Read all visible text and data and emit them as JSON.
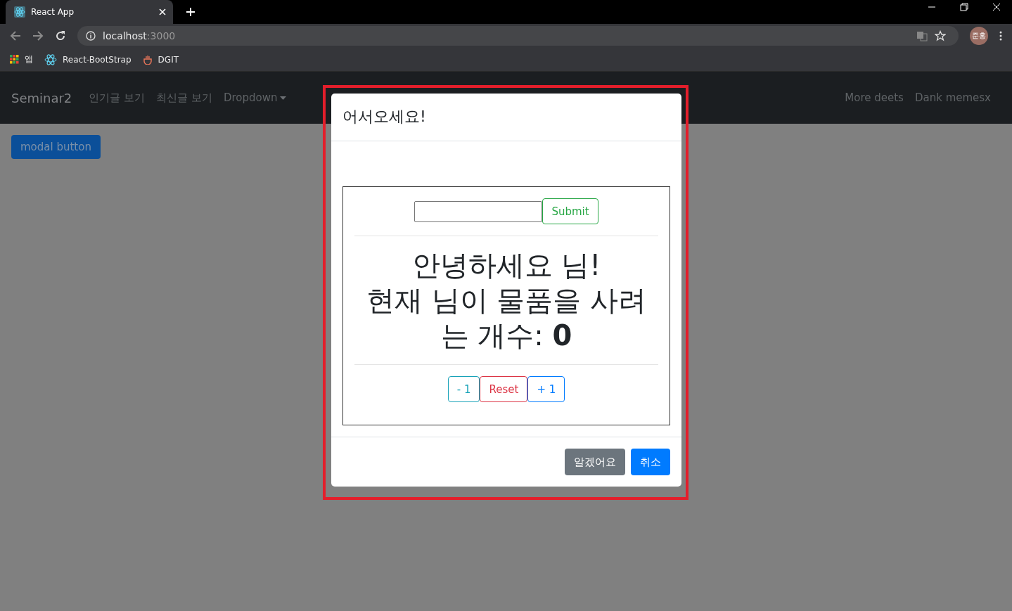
{
  "browser": {
    "tab_title": "React App",
    "url_host": "localhost",
    "url_port": ":3000",
    "bookmarks": [
      {
        "label": "앱",
        "kind": "apps"
      },
      {
        "label": "React-BootStrap",
        "kind": "react"
      },
      {
        "label": "DGIT",
        "kind": "dgit"
      }
    ],
    "profile": "준홍"
  },
  "navbar": {
    "brand": "Seminar2",
    "links": [
      "인기글 보기",
      "최신글 보기"
    ],
    "dropdown": "Dropdown",
    "right_links": [
      "More deets",
      "Dank memesx"
    ]
  },
  "modal_button": "modal button",
  "modal": {
    "title": "어서오세요!",
    "submit": "Submit",
    "greeting": "안녕하세요 님!",
    "count_line": "현재 님이 물품을 사려는 개수: **0**",
    "counter_buttons": [
      {
        "label": "- 1",
        "kind": "info"
      },
      {
        "label": "Reset",
        "kind": "danger"
      },
      {
        "label": "+ 1",
        "kind": "primary"
      }
    ],
    "footer_buttons": [
      {
        "label": "알겠어요",
        "kind": "secondary"
      },
      {
        "label": "취소",
        "kind": "primary"
      }
    ]
  }
}
